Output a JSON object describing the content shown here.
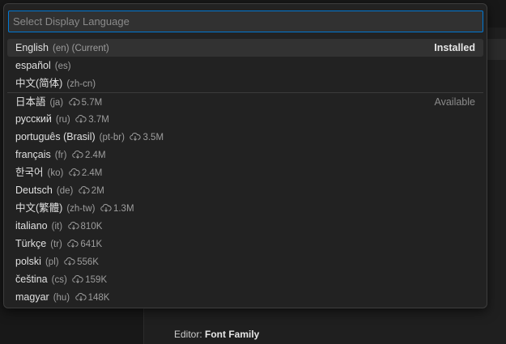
{
  "background": {
    "setting_prefix": "Editor: ",
    "setting_name": "Font Family"
  },
  "quick_pick": {
    "placeholder": "Select Display Language",
    "groups": {
      "installed": "Installed",
      "available": "Available"
    },
    "items": [
      {
        "name": "English",
        "code": "(en) (Current)",
        "size": ""
      },
      {
        "name": "español",
        "code": "(es)",
        "size": ""
      },
      {
        "name": "中文(简体)",
        "code": "(zh-cn)",
        "size": ""
      },
      {
        "name": "日本語",
        "code": "(ja)",
        "size": "5.7M"
      },
      {
        "name": "русский",
        "code": "(ru)",
        "size": "3.7M"
      },
      {
        "name": "português (Brasil)",
        "code": "(pt-br)",
        "size": "3.5M"
      },
      {
        "name": "français",
        "code": "(fr)",
        "size": "2.4M"
      },
      {
        "name": "한국어",
        "code": "(ko)",
        "size": "2.4M"
      },
      {
        "name": "Deutsch",
        "code": "(de)",
        "size": "2M"
      },
      {
        "name": "中文(繁體)",
        "code": "(zh-tw)",
        "size": "1.3M"
      },
      {
        "name": "italiano",
        "code": "(it)",
        "size": "810K"
      },
      {
        "name": "Türkçe",
        "code": "(tr)",
        "size": "641K"
      },
      {
        "name": "polski",
        "code": "(pl)",
        "size": "556K"
      },
      {
        "name": "čeština",
        "code": "(cs)",
        "size": "159K"
      },
      {
        "name": "magyar",
        "code": "(hu)",
        "size": "148K"
      }
    ]
  },
  "icons": {
    "download": "cloud-download-icon"
  },
  "colors": {
    "accent": "#0078d4",
    "selected_row": "#323232"
  }
}
